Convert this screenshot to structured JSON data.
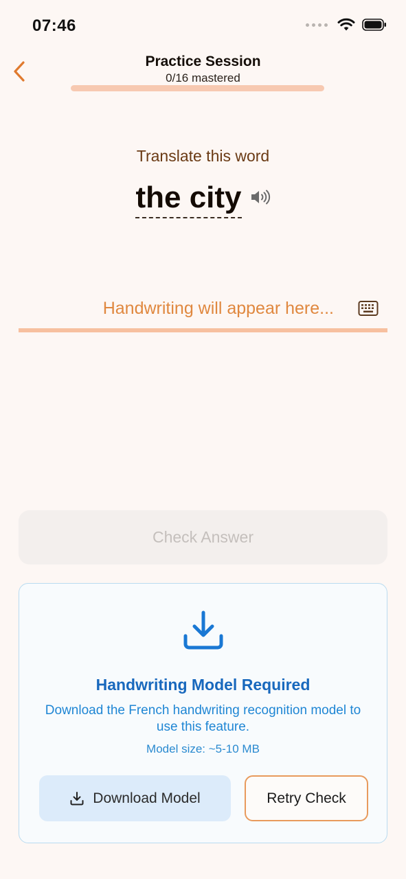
{
  "status_bar": {
    "time": "07:46",
    "icons": [
      "signal-dots-icon",
      "wifi-icon",
      "battery-icon"
    ]
  },
  "header": {
    "back_icon": "chevron-left-icon",
    "title": "Practice Session",
    "subtitle": "0/16 mastered",
    "progress": 0
  },
  "prompt": {
    "label": "Translate this word",
    "word": "the city",
    "audio_icon": "speaker-icon"
  },
  "answer_input": {
    "placeholder": "Handwriting will appear here...",
    "keyboard_icon": "keyboard-icon"
  },
  "check_button": {
    "label": "Check Answer",
    "enabled": false
  },
  "model_card": {
    "icon": "download-icon",
    "title": "Handwriting Model Required",
    "description": "Download the French handwriting recognition model to use this feature.",
    "size_text": "Model size: ~5-10 MB",
    "download_label": "Download Model",
    "retry_label": "Retry Check"
  },
  "colors": {
    "accent": "#e07a2e",
    "background": "#fdf7f4",
    "progress_track": "#f7c9b1",
    "info_blue": "#1868bd",
    "download_button_bg": "#dcebfa",
    "retry_border": "#e89a5c"
  }
}
